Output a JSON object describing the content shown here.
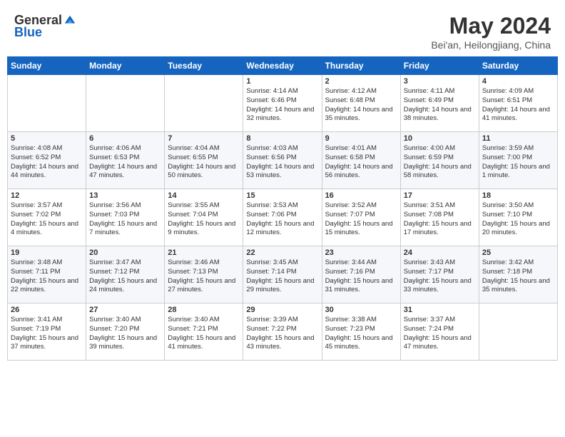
{
  "header": {
    "logo_general": "General",
    "logo_blue": "Blue",
    "month": "May 2024",
    "location": "Bei'an, Heilongjiang, China"
  },
  "weekdays": [
    "Sunday",
    "Monday",
    "Tuesday",
    "Wednesday",
    "Thursday",
    "Friday",
    "Saturday"
  ],
  "weeks": [
    [
      {
        "day": "",
        "sunrise": "",
        "sunset": "",
        "daylight": ""
      },
      {
        "day": "",
        "sunrise": "",
        "sunset": "",
        "daylight": ""
      },
      {
        "day": "",
        "sunrise": "",
        "sunset": "",
        "daylight": ""
      },
      {
        "day": "1",
        "sunrise": "Sunrise: 4:14 AM",
        "sunset": "Sunset: 6:46 PM",
        "daylight": "Daylight: 14 hours and 32 minutes."
      },
      {
        "day": "2",
        "sunrise": "Sunrise: 4:12 AM",
        "sunset": "Sunset: 6:48 PM",
        "daylight": "Daylight: 14 hours and 35 minutes."
      },
      {
        "day": "3",
        "sunrise": "Sunrise: 4:11 AM",
        "sunset": "Sunset: 6:49 PM",
        "daylight": "Daylight: 14 hours and 38 minutes."
      },
      {
        "day": "4",
        "sunrise": "Sunrise: 4:09 AM",
        "sunset": "Sunset: 6:51 PM",
        "daylight": "Daylight: 14 hours and 41 minutes."
      }
    ],
    [
      {
        "day": "5",
        "sunrise": "Sunrise: 4:08 AM",
        "sunset": "Sunset: 6:52 PM",
        "daylight": "Daylight: 14 hours and 44 minutes."
      },
      {
        "day": "6",
        "sunrise": "Sunrise: 4:06 AM",
        "sunset": "Sunset: 6:53 PM",
        "daylight": "Daylight: 14 hours and 47 minutes."
      },
      {
        "day": "7",
        "sunrise": "Sunrise: 4:04 AM",
        "sunset": "Sunset: 6:55 PM",
        "daylight": "Daylight: 14 hours and 50 minutes."
      },
      {
        "day": "8",
        "sunrise": "Sunrise: 4:03 AM",
        "sunset": "Sunset: 6:56 PM",
        "daylight": "Daylight: 14 hours and 53 minutes."
      },
      {
        "day": "9",
        "sunrise": "Sunrise: 4:01 AM",
        "sunset": "Sunset: 6:58 PM",
        "daylight": "Daylight: 14 hours and 56 minutes."
      },
      {
        "day": "10",
        "sunrise": "Sunrise: 4:00 AM",
        "sunset": "Sunset: 6:59 PM",
        "daylight": "Daylight: 14 hours and 58 minutes."
      },
      {
        "day": "11",
        "sunrise": "Sunrise: 3:59 AM",
        "sunset": "Sunset: 7:00 PM",
        "daylight": "Daylight: 15 hours and 1 minute."
      }
    ],
    [
      {
        "day": "12",
        "sunrise": "Sunrise: 3:57 AM",
        "sunset": "Sunset: 7:02 PM",
        "daylight": "Daylight: 15 hours and 4 minutes."
      },
      {
        "day": "13",
        "sunrise": "Sunrise: 3:56 AM",
        "sunset": "Sunset: 7:03 PM",
        "daylight": "Daylight: 15 hours and 7 minutes."
      },
      {
        "day": "14",
        "sunrise": "Sunrise: 3:55 AM",
        "sunset": "Sunset: 7:04 PM",
        "daylight": "Daylight: 15 hours and 9 minutes."
      },
      {
        "day": "15",
        "sunrise": "Sunrise: 3:53 AM",
        "sunset": "Sunset: 7:06 PM",
        "daylight": "Daylight: 15 hours and 12 minutes."
      },
      {
        "day": "16",
        "sunrise": "Sunrise: 3:52 AM",
        "sunset": "Sunset: 7:07 PM",
        "daylight": "Daylight: 15 hours and 15 minutes."
      },
      {
        "day": "17",
        "sunrise": "Sunrise: 3:51 AM",
        "sunset": "Sunset: 7:08 PM",
        "daylight": "Daylight: 15 hours and 17 minutes."
      },
      {
        "day": "18",
        "sunrise": "Sunrise: 3:50 AM",
        "sunset": "Sunset: 7:10 PM",
        "daylight": "Daylight: 15 hours and 20 minutes."
      }
    ],
    [
      {
        "day": "19",
        "sunrise": "Sunrise: 3:48 AM",
        "sunset": "Sunset: 7:11 PM",
        "daylight": "Daylight: 15 hours and 22 minutes."
      },
      {
        "day": "20",
        "sunrise": "Sunrise: 3:47 AM",
        "sunset": "Sunset: 7:12 PM",
        "daylight": "Daylight: 15 hours and 24 minutes."
      },
      {
        "day": "21",
        "sunrise": "Sunrise: 3:46 AM",
        "sunset": "Sunset: 7:13 PM",
        "daylight": "Daylight: 15 hours and 27 minutes."
      },
      {
        "day": "22",
        "sunrise": "Sunrise: 3:45 AM",
        "sunset": "Sunset: 7:14 PM",
        "daylight": "Daylight: 15 hours and 29 minutes."
      },
      {
        "day": "23",
        "sunrise": "Sunrise: 3:44 AM",
        "sunset": "Sunset: 7:16 PM",
        "daylight": "Daylight: 15 hours and 31 minutes."
      },
      {
        "day": "24",
        "sunrise": "Sunrise: 3:43 AM",
        "sunset": "Sunset: 7:17 PM",
        "daylight": "Daylight: 15 hours and 33 minutes."
      },
      {
        "day": "25",
        "sunrise": "Sunrise: 3:42 AM",
        "sunset": "Sunset: 7:18 PM",
        "daylight": "Daylight: 15 hours and 35 minutes."
      }
    ],
    [
      {
        "day": "26",
        "sunrise": "Sunrise: 3:41 AM",
        "sunset": "Sunset: 7:19 PM",
        "daylight": "Daylight: 15 hours and 37 minutes."
      },
      {
        "day": "27",
        "sunrise": "Sunrise: 3:40 AM",
        "sunset": "Sunset: 7:20 PM",
        "daylight": "Daylight: 15 hours and 39 minutes."
      },
      {
        "day": "28",
        "sunrise": "Sunrise: 3:40 AM",
        "sunset": "Sunset: 7:21 PM",
        "daylight": "Daylight: 15 hours and 41 minutes."
      },
      {
        "day": "29",
        "sunrise": "Sunrise: 3:39 AM",
        "sunset": "Sunset: 7:22 PM",
        "daylight": "Daylight: 15 hours and 43 minutes."
      },
      {
        "day": "30",
        "sunrise": "Sunrise: 3:38 AM",
        "sunset": "Sunset: 7:23 PM",
        "daylight": "Daylight: 15 hours and 45 minutes."
      },
      {
        "day": "31",
        "sunrise": "Sunrise: 3:37 AM",
        "sunset": "Sunset: 7:24 PM",
        "daylight": "Daylight: 15 hours and 47 minutes."
      },
      {
        "day": "",
        "sunrise": "",
        "sunset": "",
        "daylight": ""
      }
    ]
  ]
}
